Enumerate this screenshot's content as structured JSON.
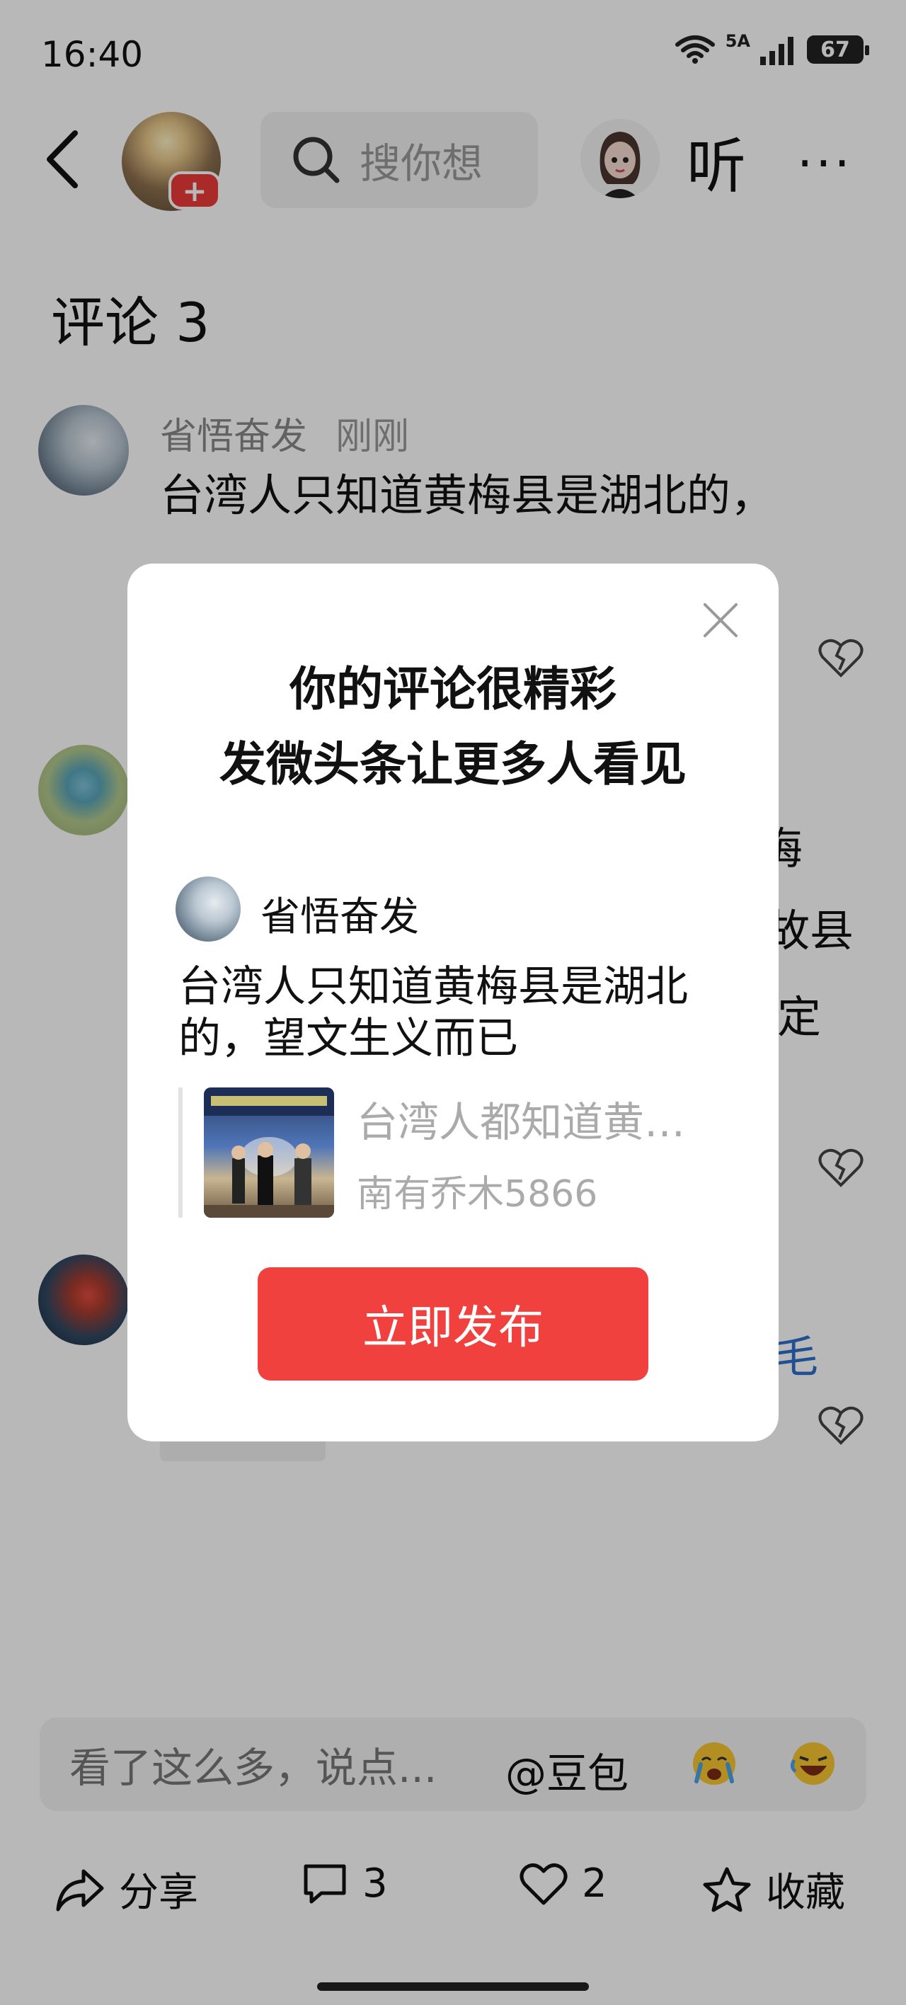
{
  "status_bar": {
    "time": "16:40",
    "network": "5A",
    "battery": "67"
  },
  "header": {
    "search_placeholder": "搜你想",
    "listen_label": "听",
    "more_label": "···"
  },
  "comments": {
    "title": "评论 3",
    "first": {
      "user": "省悟奋发",
      "time": "刚刚",
      "text": "台湾人只知道黄梅县是湖北的，",
      "text_cut": "望文生义而已"
    },
    "second_fragments": [
      "梅",
      "故县",
      "定"
    ],
    "third_fragment": "毛"
  },
  "bottom": {
    "input_placeholder": "看了这么多，说点...",
    "mention": "@豆包",
    "share_label": "分享",
    "comment_count": "3",
    "like_count": "2",
    "collect_label": "收藏"
  },
  "modal": {
    "title_line1": "你的评论很精彩",
    "title_line2": "发微头条让更多人看见",
    "user": "省悟奋发",
    "text": "台湾人只知道黄梅县是湖北的，望文生义而已",
    "quote_title": "台湾人都知道黄梅戏",
    "quote_author": "南有乔木5866",
    "publish_label": "立即发布"
  }
}
